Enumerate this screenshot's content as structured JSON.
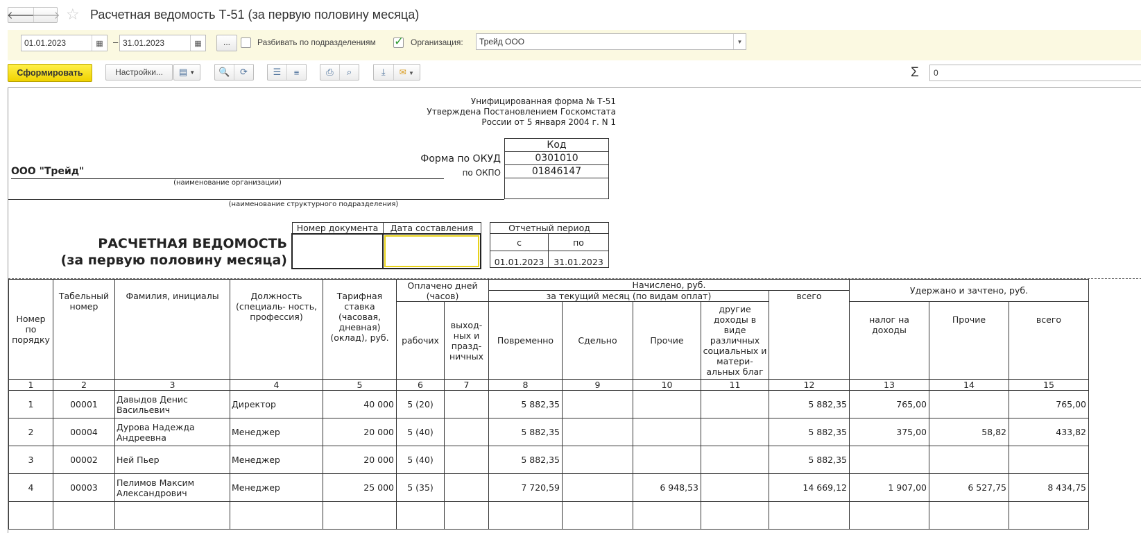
{
  "window": {
    "title": "Расчетная ведомость Т-51 (за первую половину месяца)",
    "back_icon": "arrow-left-icon",
    "forward_icon": "arrow-right-icon",
    "favorite_icon": "star-icon"
  },
  "filters": {
    "date_from": "01.01.2023",
    "date_to": "31.01.2023",
    "date_separator": "–",
    "more_label": "...",
    "split_label": "Разбивать по подразделениям",
    "split_checked": false,
    "org_checked": true,
    "org_label": "Организация:",
    "org_value": "Трейд ООО"
  },
  "toolbar": {
    "generate_label": "Сформировать",
    "settings_label": "Настройки...",
    "sum_value": "0"
  },
  "report": {
    "form_note_1": "Унифицированная форма № Т-51",
    "form_note_2": "Утверждена Постановлением Госкомстата",
    "form_note_3": "России от 5 января 2004 г. N 1",
    "code_header": "Код",
    "okud_label": "Форма по ОКУД",
    "okud_value": "0301010",
    "okpo_label": "по ОКПО",
    "okpo_value": "01846147",
    "org_name": "ООО \"Трейд\"",
    "org_caption": "(наименование организации)",
    "dept_caption": "(наименование структурного подразделения)",
    "title_line1": "РАСЧЕТНАЯ ВЕДОМОСТЬ",
    "title_line2": "(за первую половину месяца)",
    "doc_number_header": "Номер документа",
    "doc_date_header": "Дата составления",
    "period_header": "Отчетный период",
    "period_from_label": "с",
    "period_to_label": "по",
    "period_from": "01.01.2023",
    "period_to": "31.01.2023"
  },
  "table": {
    "h_num": "Номер по порядку",
    "h_tab": "Табельный номер",
    "h_fio": "Фамилия, инициалы",
    "h_pos": "Должность (специаль- ность, профессия)",
    "h_rate": "Тарифная ставка (часовая, дневная) (оклад), руб.",
    "h_paid": "Оплачено дней (часов)",
    "h_work": "рабочих",
    "h_holiday": "выход- ных и празд- ничных",
    "h_accrued": "Начислено, руб.",
    "h_current": "за текущий месяц (по видам оплат)",
    "h_time": "Повременно",
    "h_piece": "Сдельно",
    "h_other": "Прочие",
    "h_social": "другие доходы в виде различных социальных и матери- альных благ",
    "h_total": "всего",
    "h_withheld": "Удержано и зачтено, руб.",
    "h_tax": "налог на доходы",
    "h_w_other": "Прочие",
    "h_w_total": "всего",
    "col_numbers": [
      "1",
      "2",
      "3",
      "4",
      "5",
      "6",
      "7",
      "8",
      "9",
      "10",
      "11",
      "12",
      "13",
      "14",
      "15"
    ],
    "rows": [
      {
        "num": "1",
        "tab": "00001",
        "fio": "Давыдов Денис Васильевич",
        "pos": "Директор",
        "rate": "40 000",
        "work": "5 (20)",
        "hol": "",
        "time": "5 882,35",
        "piece": "",
        "other": "",
        "social": "",
        "total": "5 882,35",
        "tax": "765,00",
        "w_other": "",
        "w_total": "765,00"
      },
      {
        "num": "2",
        "tab": "00004",
        "fio": "Дурова Надежда Андреевна",
        "pos": "Менеджер",
        "rate": "20 000",
        "work": "5 (40)",
        "hol": "",
        "time": "5 882,35",
        "piece": "",
        "other": "",
        "social": "",
        "total": "5 882,35",
        "tax": "375,00",
        "w_other": "58,82",
        "w_total": "433,82"
      },
      {
        "num": "3",
        "tab": "00002",
        "fio": "Ней Пьер",
        "pos": "Менеджер",
        "rate": "20 000",
        "work": "5 (40)",
        "hol": "",
        "time": "5 882,35",
        "piece": "",
        "other": "",
        "social": "",
        "total": "5 882,35",
        "tax": "",
        "w_other": "",
        "w_total": ""
      },
      {
        "num": "4",
        "tab": "00003",
        "fio": "Пелимов Максим Александрович",
        "pos": "Менеджер",
        "rate": "25 000",
        "work": "5 (35)",
        "hol": "",
        "time": "7 720,59",
        "piece": "",
        "other": "6 948,53",
        "social": "",
        "total": "14 669,12",
        "tax": "1 907,00",
        "w_other": "6 527,75",
        "w_total": "8 434,75"
      }
    ]
  }
}
